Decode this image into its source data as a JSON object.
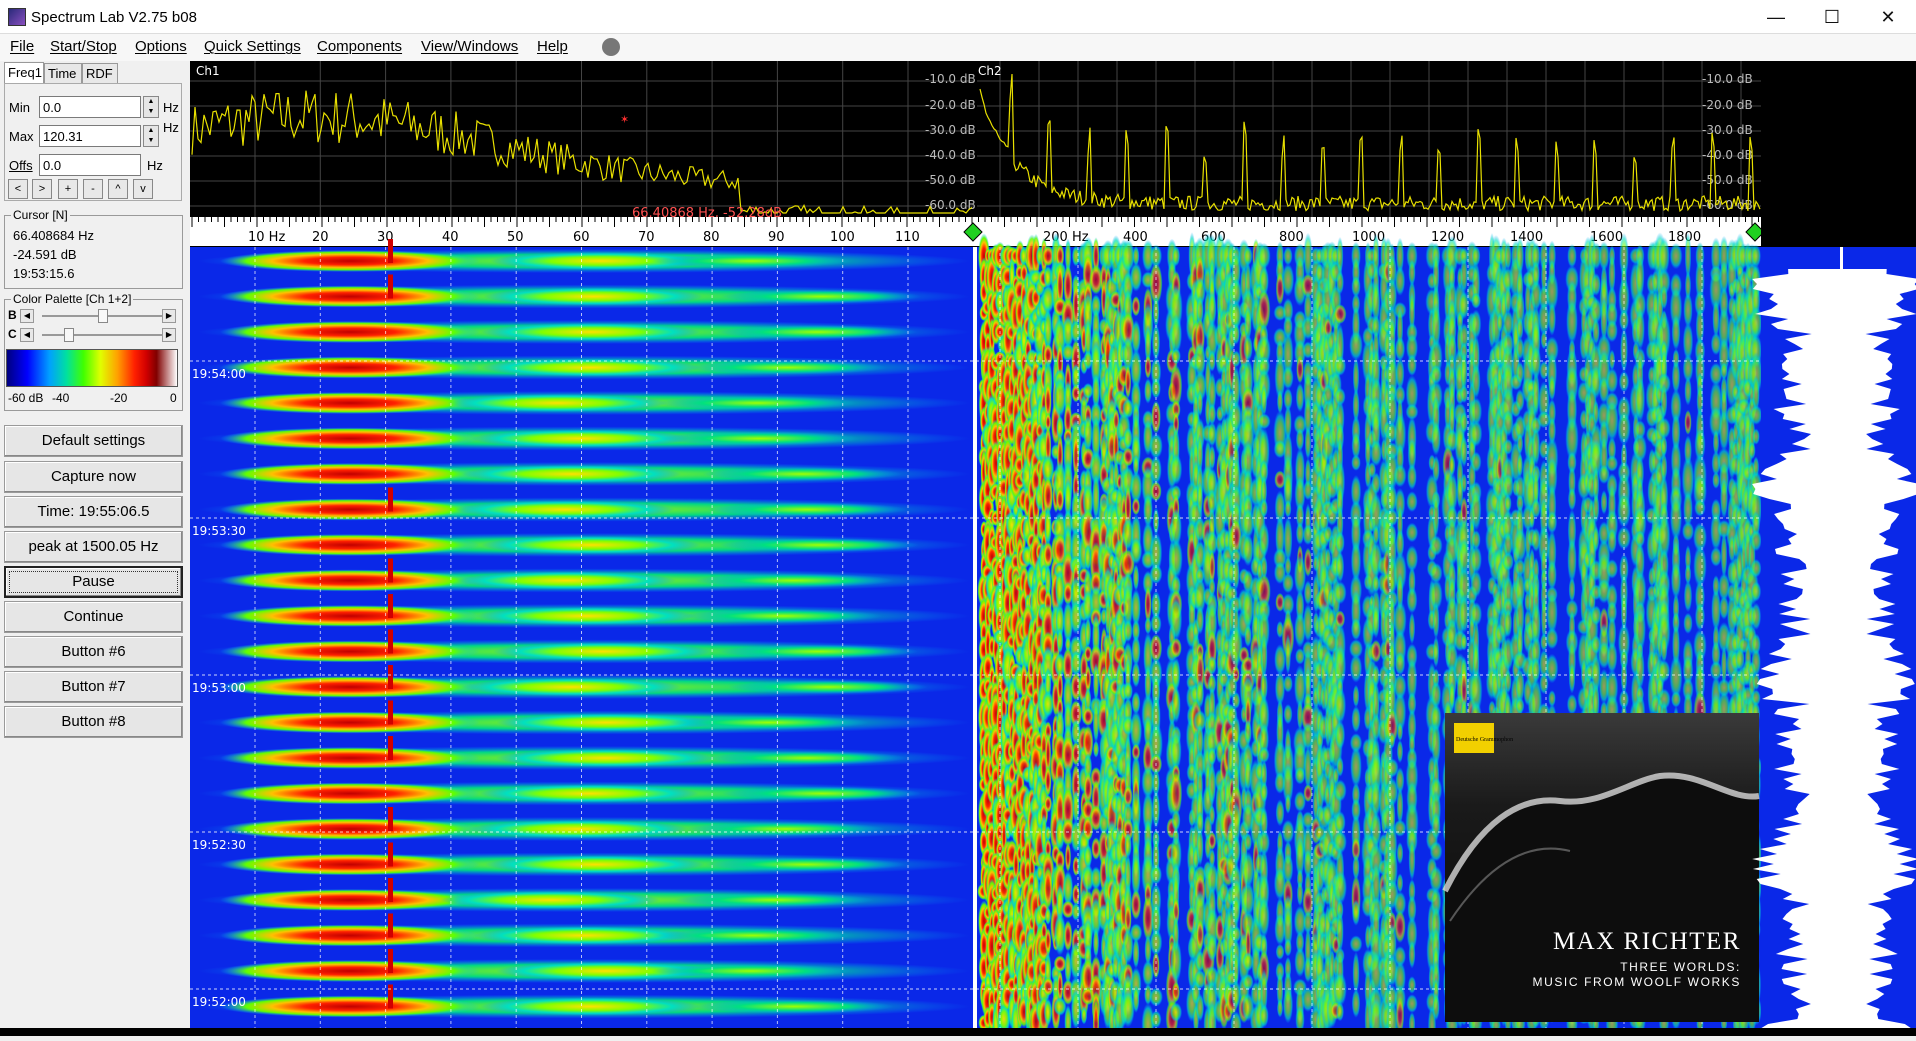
{
  "window": {
    "title": "Spectrum Lab V2.75 b08",
    "minimize": "—",
    "maximize": "☐",
    "close": "✕"
  },
  "menu": [
    "File",
    "Start/Stop",
    "Options",
    "Quick Settings",
    "Components",
    "View/Windows",
    "Help"
  ],
  "left": {
    "tabs": [
      "Freq1",
      "Time",
      "RDF"
    ],
    "min_label": "Min",
    "min_value": "0.0",
    "max_label": "Max",
    "max_value": "120.31",
    "offs_label": "Offs",
    "offs_value": "0.0",
    "hz_unit": "Hz",
    "step_buttons": [
      "<",
      ">",
      "+",
      "-",
      "^",
      "v"
    ],
    "cursor_title": "Cursor [N]",
    "cursor_freq": "66.408684 Hz",
    "cursor_db": "-24.591 dB",
    "cursor_time": "19:53:15.6",
    "palette_title": "Color Palette [Ch 1+2]",
    "palette_b": "B",
    "palette_c": "C",
    "palette_scale": [
      "-60 dB",
      "-40",
      "-20",
      "0"
    ],
    "buttons": [
      "Default settings",
      "Capture now",
      "Time:  19:55:06.5",
      "peak at 1500.05 Hz",
      "Pause",
      "Continue",
      "Button #6",
      "Button #7",
      "Button #8"
    ]
  },
  "spectrum": {
    "ch1_label": "Ch1",
    "ch2_label": "Ch2",
    "db_labels": [
      "-10.0 dB",
      "-20.0 dB",
      "-30.0 dB",
      "-40.0 dB",
      "-50.0 dB",
      "-60.0 dB"
    ],
    "ch1_freq_labels": [
      "10 Hz",
      "20",
      "30",
      "40",
      "50",
      "60",
      "70",
      "80",
      "90",
      "100",
      "110"
    ],
    "ch2_freq_labels": [
      "200 Hz",
      "400",
      "600",
      "800",
      "1000",
      "1200",
      "1400",
      "1600",
      "1800"
    ],
    "cursor_readout": "66.40868 Hz, -52.28dB",
    "trace_color": "#e8e000"
  },
  "waterfall": {
    "time_labels": [
      "19:54:00",
      "19:53:30",
      "19:53:00",
      "19:52:30",
      "19:52:00"
    ]
  },
  "album": {
    "label": "Deutsche Grammophon",
    "artist": "MAX RICHTER",
    "line1": "THREE WORLDS:",
    "line2": "MUSIC FROM WOOLF WORKS"
  }
}
